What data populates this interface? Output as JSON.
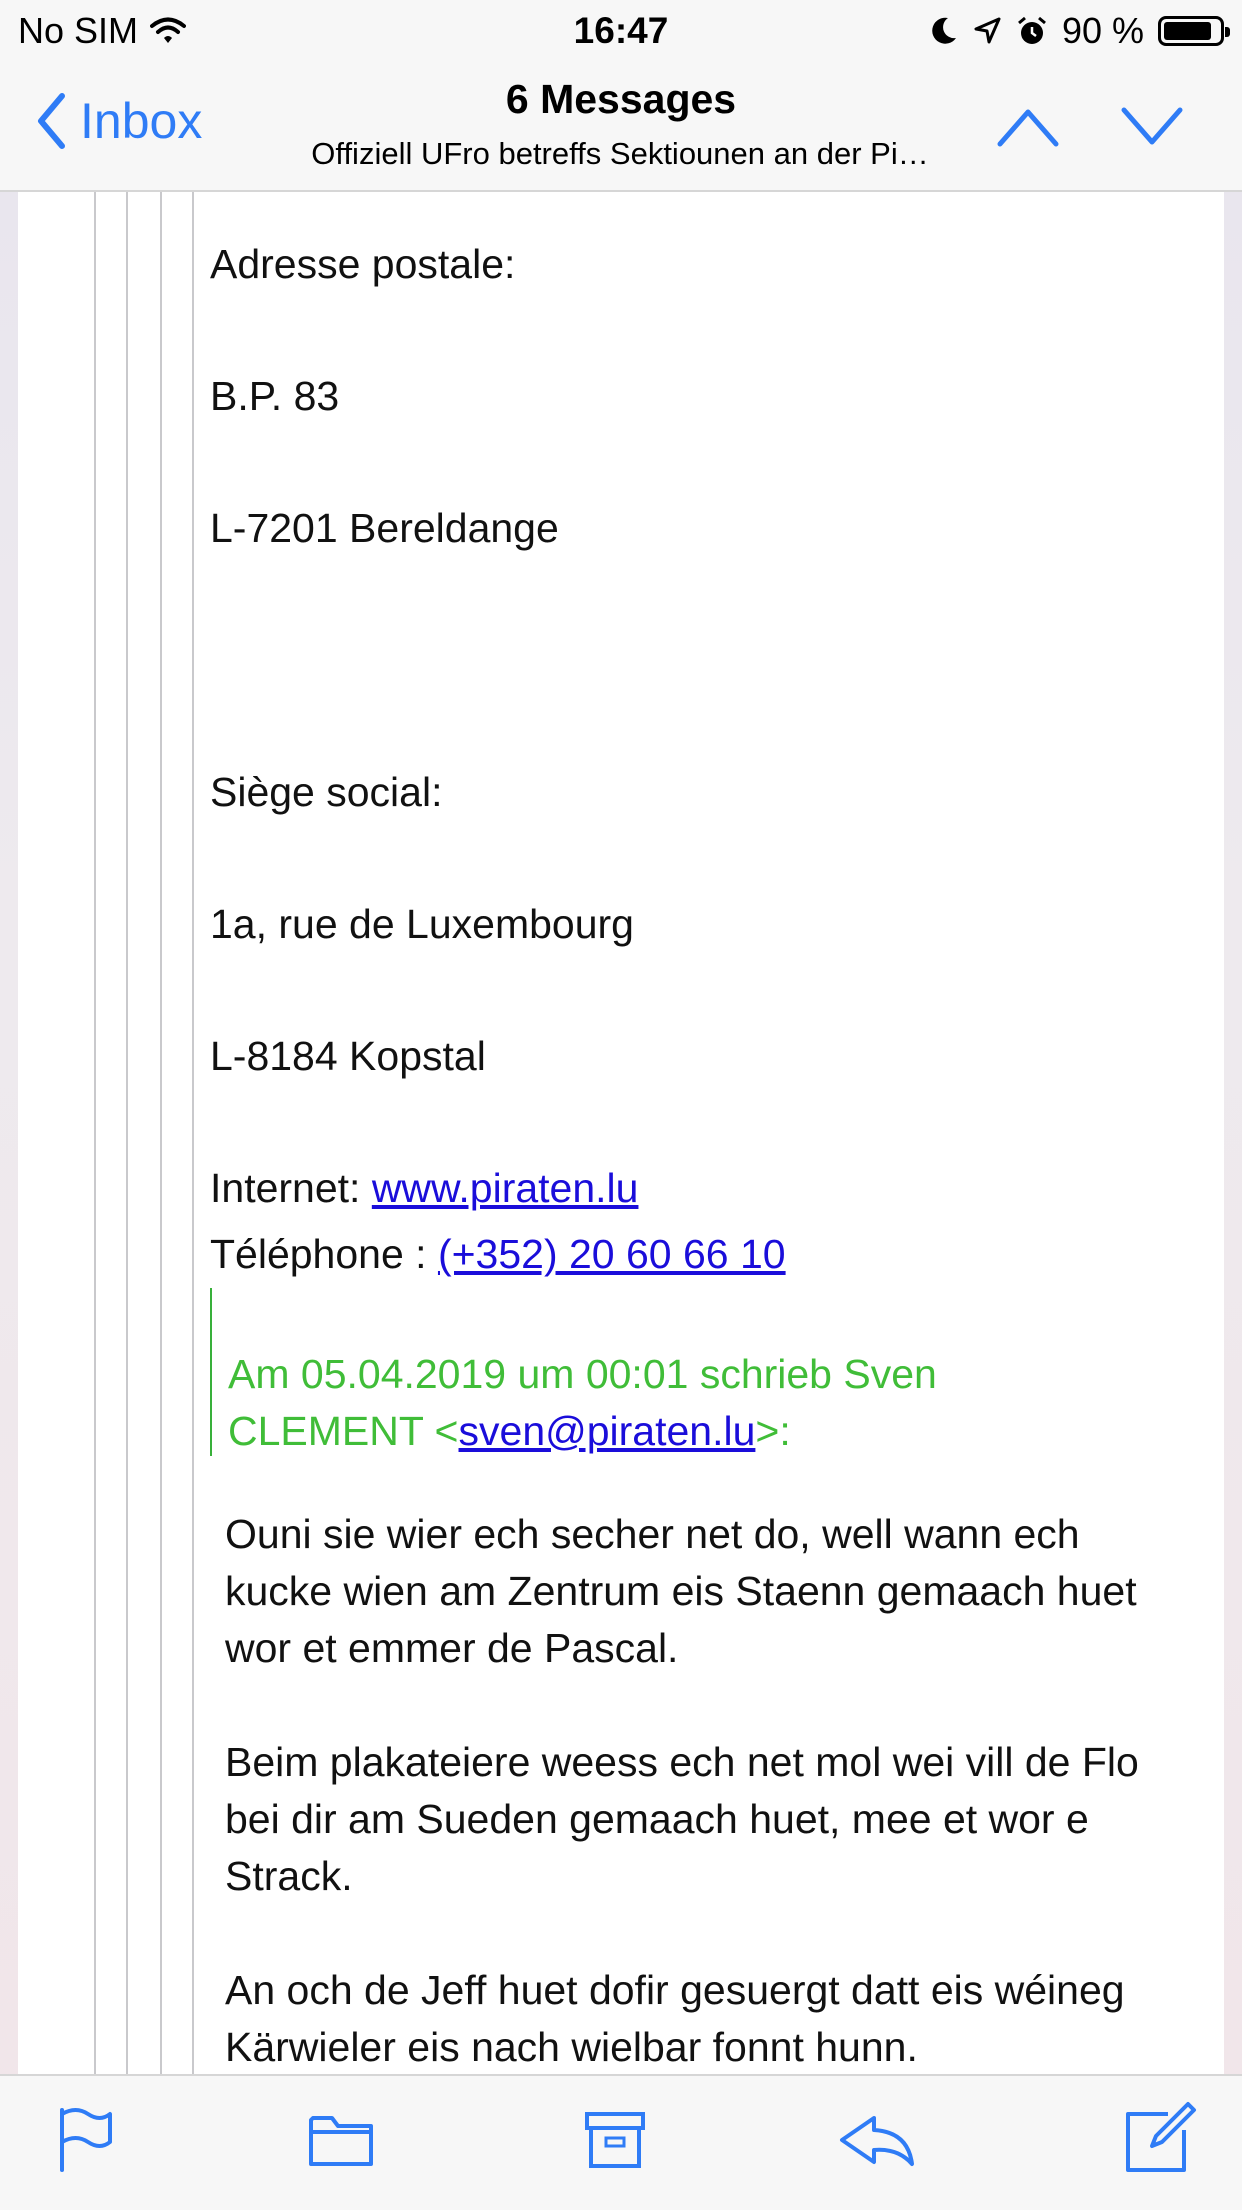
{
  "status_bar": {
    "carrier": "No SIM",
    "time": "16:47",
    "battery_percent": "90 %",
    "icons": [
      "wifi-icon",
      "moon-icon",
      "location-arrow-icon",
      "alarm-icon",
      "battery-icon"
    ]
  },
  "nav": {
    "back_label": "Inbox",
    "title": "6 Messages",
    "subtitle": "Offiziell UFro betreffs Sektiounen an der Pi…",
    "accent_color": "#2f7cf6"
  },
  "email": {
    "postal_label": "Adresse postale:",
    "po_box": "B.P. 83",
    "postal_city": "L-7201 Bereldange",
    "seat_label": "Siège social:",
    "seat_street": "1a, rue de Luxembourg",
    "seat_city": "L-8184 Kopstal",
    "internet_label": "Internet: ",
    "internet_link": "www.piraten.lu",
    "phone_label": "Téléphone : ",
    "phone_link": "(+352) 20 60 66 10",
    "quote_header_prefix": "Am 05.04.2019 um 00:01 schrieb Sven CLEMENT <",
    "quote_header_email": "sven@piraten.lu",
    "quote_header_suffix": ">:",
    "quote_color": "#40bd38",
    "link_color": "#1a0dda",
    "paragraph_1": "Ouni sie wier ech secher net do, well wann ech kucke wien am Zentrum eis Staenn gemaach huet wor et emmer de Pascal.",
    "paragraph_2": "Beim plakateiere weess ech net mol wei vill de Flo bei dir am Sueden gemaach huet, mee et wor e Strack.",
    "paragraph_3": "An och de Jeff huet dofir gesuergt datt eis wéineg Kärwieler eis nach wielbar fonnt hunn."
  },
  "toolbar": {
    "buttons": [
      "flag-icon",
      "folder-icon",
      "archive-icon",
      "reply-icon",
      "compose-icon"
    ]
  }
}
